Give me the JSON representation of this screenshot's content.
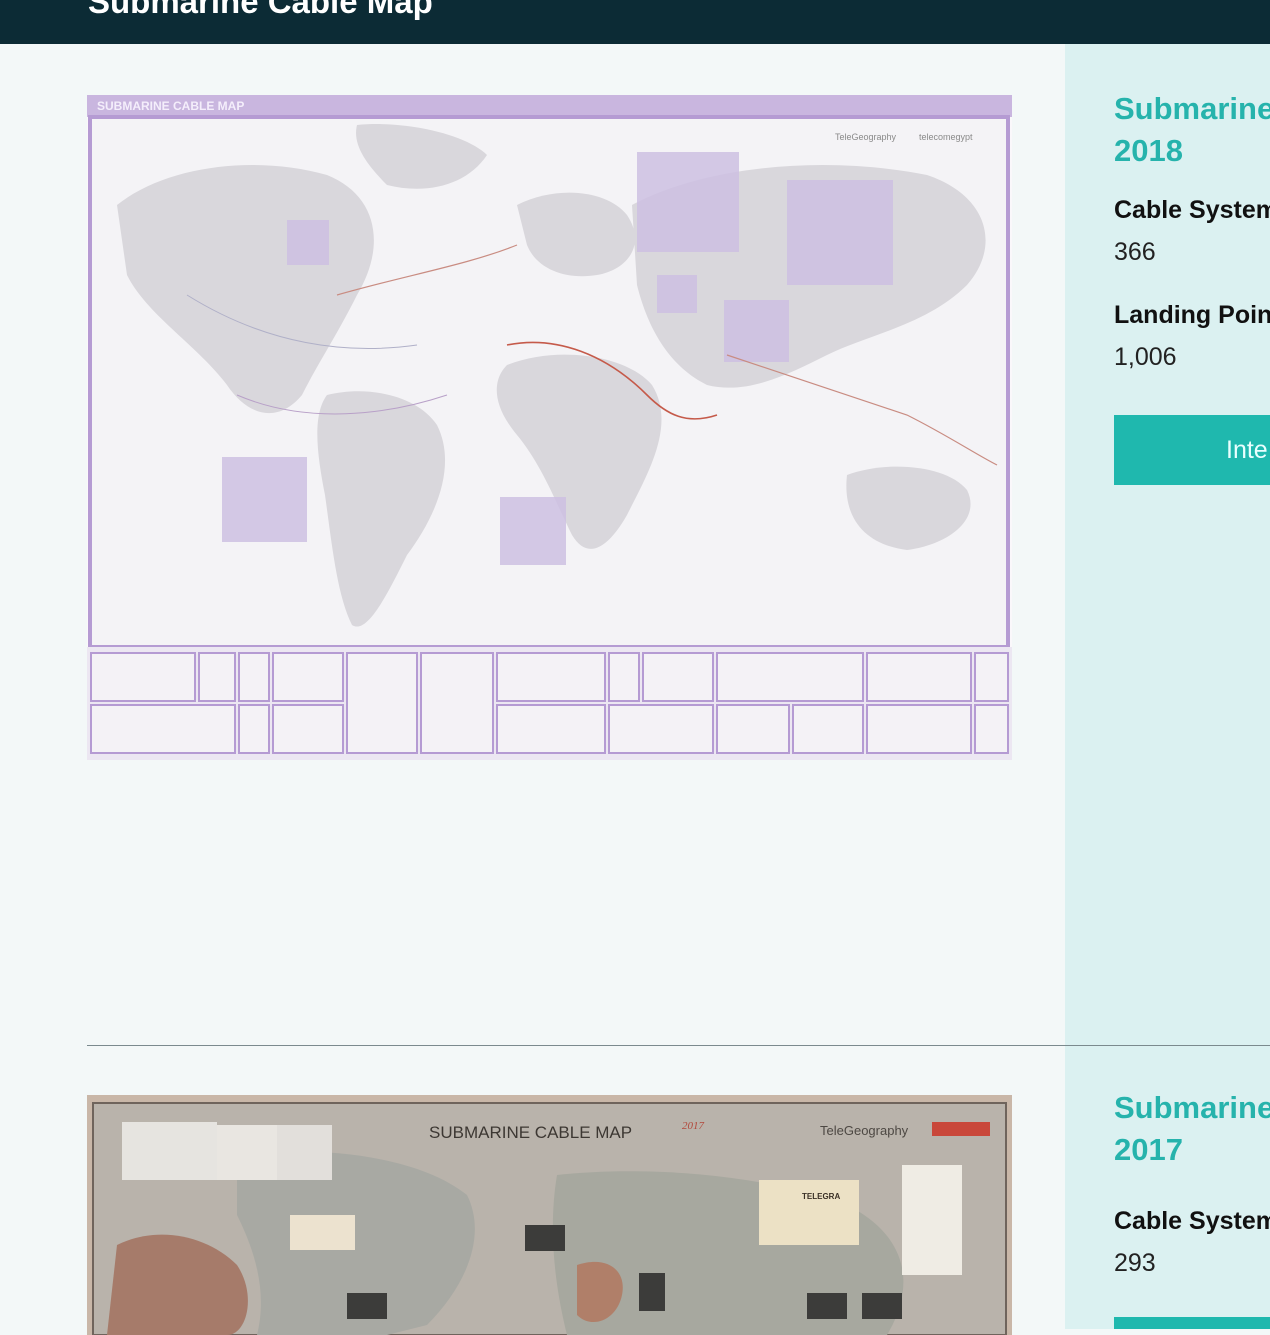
{
  "header": {
    "title": "Submarine Cable Map"
  },
  "entries": [
    {
      "title_line1": "Submarine",
      "title_line2": "2018",
      "cable_label": "Cable System",
      "cable_value": "366",
      "landing_label": "Landing Poin",
      "landing_value": "1,006",
      "button_label": "Inte",
      "map": {
        "banner": "SUBMARINE CABLE MAP",
        "brand_a": "TeleGeography",
        "brand_b": "telecomegypt"
      }
    },
    {
      "title_line1": "Submarine",
      "title_line2": "2017",
      "cable_label": "Cable System",
      "cable_value": "293",
      "map": {
        "banner": "SUBMARINE  CABLE  MAP",
        "year_tag": "2017",
        "brand_a": "TeleGeography",
        "brand_b": "TELEGRA"
      }
    }
  ],
  "colors": {
    "accent": "#1fb8ae",
    "topbar": "#0c2b35",
    "sidebar": "#dbf1f1"
  }
}
